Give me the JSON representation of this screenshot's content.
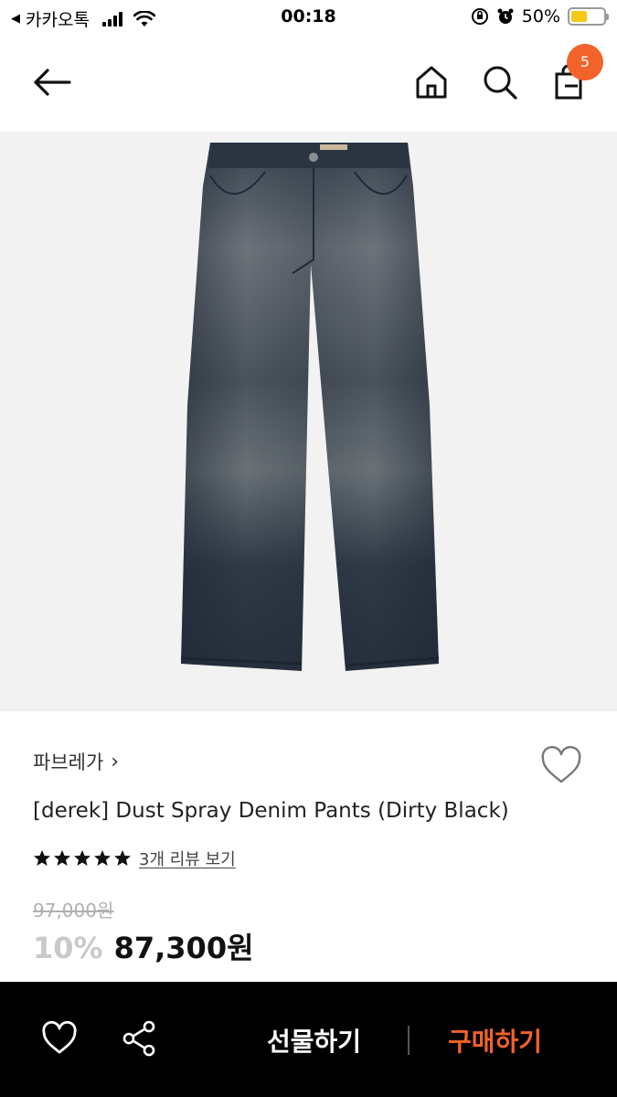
{
  "status_bar": {
    "back_label": "카카오톡",
    "time": "00:18",
    "battery_text": "50%",
    "battery_level": 0.5,
    "battery_color": "#f3c81a"
  },
  "nav": {
    "cart_count": "5",
    "accent_color": "#f2622b",
    "icons": [
      "back-arrow-icon",
      "home-icon",
      "search-icon",
      "shopping-bag-icon"
    ]
  },
  "product": {
    "brand": "파브레가",
    "name": "[derek] Dust Spray Denim Pants (Dirty Black)",
    "rating_stars": 5,
    "review_link": "3개 리뷰 보기",
    "original_price": "97,000원",
    "discount": "10%",
    "sale_price": "87,300원"
  },
  "bottom_bar": {
    "gift_label": "선물하기",
    "buy_label": "구매하기",
    "buy_color": "#f2622b",
    "icons": [
      "heart-icon",
      "share-icon"
    ]
  }
}
